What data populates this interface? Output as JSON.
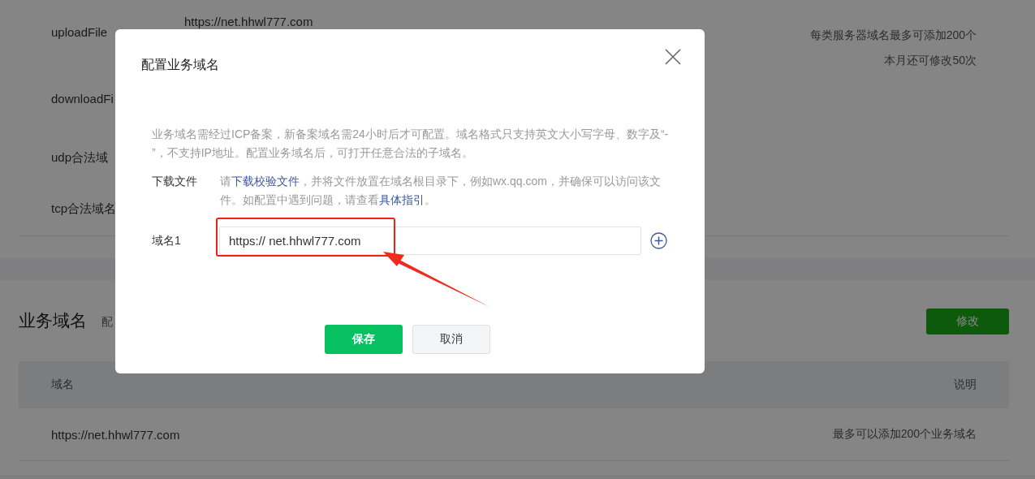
{
  "background": {
    "server_domains": {
      "rows": [
        {
          "label": "uploadFile",
          "value": "https://net.hhwl777.com"
        },
        {
          "label": "downloadFi"
        },
        {
          "label": "udp合法域"
        },
        {
          "label": "tcp合法域名"
        }
      ],
      "notes": [
        "每类服务器域名最多可添加200个",
        "本月还可修改50次"
      ]
    },
    "business_domains": {
      "title": "业务域名",
      "subtitle": "配",
      "edit_button": "修改",
      "table": {
        "columns": [
          "域名",
          "说明"
        ],
        "rows": [
          [
            "https://net.hhwl777.com",
            "最多可以添加200个业务域名"
          ]
        ]
      }
    }
  },
  "dialog": {
    "title": "配置业务域名",
    "notice": "业务域名需经过ICP备案，新备案域名需24小时后才可配置。域名格式只支持英文大小写字母、数字及“- ”，不支持IP地址。配置业务域名后，可打开任意合法的子域名。",
    "download": {
      "label": "下载文件",
      "parts": [
        {
          "kind": "text",
          "text": "请"
        },
        {
          "kind": "link",
          "text": "下载校验文件"
        },
        {
          "kind": "text",
          "text": "，并将文件放置在域名根目录下，例如wx.qq.com，并确保可以访问该文件。如配置中遇到问题，请查看"
        },
        {
          "kind": "link",
          "text": "具体指引"
        },
        {
          "kind": "text",
          "text": "。"
        }
      ]
    },
    "domains": [
      {
        "label": "域名1",
        "value": "https:// net.hhwl777.com"
      }
    ],
    "buttons": [
      {
        "label": "保存",
        "kind": "primary"
      },
      {
        "label": "取消",
        "kind": "default"
      }
    ]
  }
}
